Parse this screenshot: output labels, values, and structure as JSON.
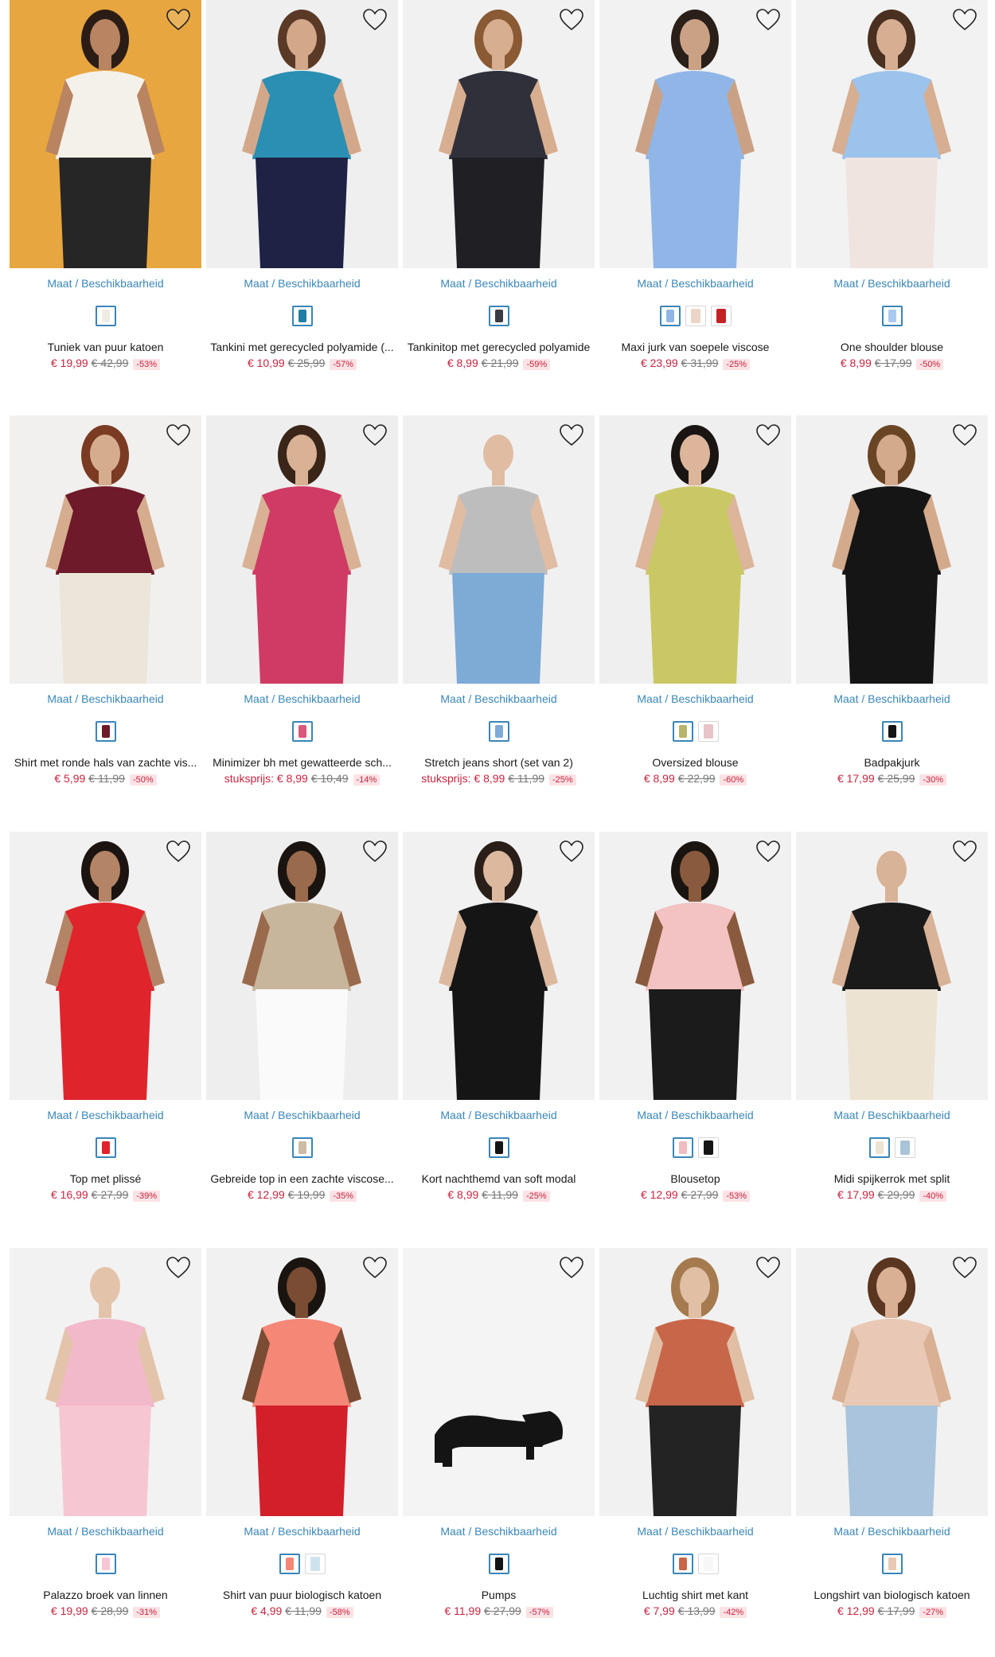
{
  "size_link_label": "Maat / Beschikbaarheid",
  "accent_color": "#3a86b8",
  "sale_color": "#c8243f",
  "icons": {
    "wishlist": "heart-outline-icon"
  },
  "products": [
    {
      "title": "Tuniek van puur katoen",
      "prefix": "",
      "price": "€ 19,99",
      "old_price": "€ 42,99",
      "discount": "-53%",
      "bg": "#e7a63f",
      "garment": "#f4f1ea",
      "lower": "#262626",
      "skin": "#b98461",
      "hair": "#2b1d16",
      "swatches": [
        "#efece4"
      ]
    },
    {
      "title": "Tankini met gerecycled polyamide (...",
      "prefix": "",
      "price": "€ 10,99",
      "old_price": "€ 25,99",
      "discount": "-57%",
      "bg": "#efefef",
      "garment": "#2a8fb3",
      "lower": "#1e2244",
      "skin": "#d3a88a",
      "hair": "#5a3a26",
      "swatches": [
        "#1f7ea3"
      ]
    },
    {
      "title": "Tankinitop met gerecycled polyamide",
      "prefix": "",
      "price": "€ 8,99",
      "old_price": "€ 21,99",
      "discount": "-59%",
      "bg": "#f1f1f1",
      "garment": "#30303a",
      "lower": "#1f1f24",
      "skin": "#d8ae90",
      "hair": "#8a5a34",
      "swatches": [
        "#3b3b44"
      ]
    },
    {
      "title": "Maxi jurk van soepele viscose",
      "prefix": "",
      "price": "€ 23,99",
      "old_price": "€ 31,99",
      "discount": "-25%",
      "bg": "#f2f2f2",
      "garment": "#8fb6e6",
      "lower": "#8fb6e6",
      "skin": "#caa184",
      "hair": "#2a1f19",
      "swatches": [
        "#8fb6e6",
        "#ead5c6",
        "#c42323"
      ]
    },
    {
      "title": "One shoulder blouse",
      "prefix": "",
      "price": "€ 8,99",
      "old_price": "€ 17,99",
      "discount": "-50%",
      "bg": "#f2f2f2",
      "garment": "#9cc3ec",
      "lower": "#f0e4e0",
      "skin": "#d6ae92",
      "hair": "#4a3020",
      "swatches": [
        "#a9c9ee"
      ]
    },
    {
      "title": "Shirt met ronde hals van zachte vis...",
      "prefix": "",
      "price": "€ 5,99",
      "old_price": "€ 11,99",
      "discount": "-50%",
      "bg": "#f1f0ee",
      "garment": "#6e1a2a",
      "lower": "#ebe5da",
      "skin": "#d6ac8e",
      "hair": "#7a3b22",
      "swatches": [
        "#6e1a2a"
      ]
    },
    {
      "title": "Minimizer bh met gewatteerde sch...",
      "prefix": "stuksprijs: ",
      "price": "€ 8,99",
      "old_price": "€ 10,49",
      "discount": "-14%",
      "bg": "#eeeeee",
      "garment": "#cf3b64",
      "lower": "#cf3b64",
      "skin": "#d9b195",
      "hair": "#3a2518",
      "swatches": [
        "#d95a7c"
      ]
    },
    {
      "title": "Stretch jeans short (set van 2)",
      "prefix": "stuksprijs: ",
      "price": "€ 8,99",
      "old_price": "€ 11,99",
      "discount": "-25%",
      "bg": "#f0f0f0",
      "garment": "#bdbdbd",
      "lower": "#7eaad6",
      "skin": "#e0bca3",
      "hair": "#f0f0f0",
      "swatches": [
        "#7eaad6"
      ]
    },
    {
      "title": "Oversized blouse",
      "prefix": "",
      "price": "€ 8,99",
      "old_price": "€ 22,99",
      "discount": "-60%",
      "bg": "#efefef",
      "garment": "#c9c865",
      "lower": "#c9c865",
      "skin": "#dcb59b",
      "hair": "#1a1512",
      "swatches": [
        "#b7b46a",
        "#e8c3c8"
      ]
    },
    {
      "title": "Badpakjurk",
      "prefix": "",
      "price": "€ 17,99",
      "old_price": "€ 25,99",
      "discount": "-30%",
      "bg": "#f1f1f1",
      "garment": "#151515",
      "lower": "#151515",
      "skin": "#d4aa8c",
      "hair": "#6a4524",
      "swatches": [
        "#151515"
      ]
    },
    {
      "title": "Top met plissé",
      "prefix": "",
      "price": "€ 16,99",
      "old_price": "€ 27,99",
      "discount": "-39%",
      "bg": "#f1f1f1",
      "garment": "#e0242b",
      "lower": "#e0242b",
      "skin": "#b48466",
      "hair": "#1c1410",
      "swatches": [
        "#e0242b"
      ]
    },
    {
      "title": "Gebreide top in een zachte viscose...",
      "prefix": "",
      "price": "€ 12,99",
      "old_price": "€ 19,99",
      "discount": "-35%",
      "bg": "#eeeeee",
      "garment": "#c8b69c",
      "lower": "#fafafa",
      "skin": "#9a6a4c",
      "hair": "#1a1410",
      "swatches": [
        "#cdbca3"
      ]
    },
    {
      "title": "Kort nachthemd van soft modal",
      "prefix": "",
      "price": "€ 8,99",
      "old_price": "€ 11,99",
      "discount": "-25%",
      "bg": "#f1f1f1",
      "garment": "#151515",
      "lower": "#151515",
      "skin": "#dcb89f",
      "hair": "#2a1e18",
      "swatches": [
        "#151515"
      ]
    },
    {
      "title": "Blousetop",
      "prefix": "",
      "price": "€ 12,99",
      "old_price": "€ 27,99",
      "discount": "-53%",
      "bg": "#f1f1f1",
      "garment": "#f3c2c2",
      "lower": "#1b1b1b",
      "skin": "#8a5a3e",
      "hair": "#1a1410",
      "swatches": [
        "#f0bcc0",
        "#151515"
      ]
    },
    {
      "title": "Midi spijkerrok met split",
      "prefix": "",
      "price": "€ 17,99",
      "old_price": "€ 29,99",
      "discount": "-40%",
      "bg": "#f1f1f1",
      "garment": "#1a1a1a",
      "lower": "#ece3d2",
      "skin": "#d9b397",
      "hair": "#f1f1f1",
      "swatches": [
        "#ece3d2",
        "#a9c4d6"
      ]
    },
    {
      "title": "Palazzo broek van linnen",
      "prefix": "",
      "price": "€ 19,99",
      "old_price": "€ 28,99",
      "discount": "-31%",
      "bg": "#f2f2f2",
      "garment": "#f2b9ca",
      "lower": "#f6c7d3",
      "skin": "#e4c3ab",
      "hair": "#f2f2f2",
      "swatches": [
        "#f6c7d3"
      ]
    },
    {
      "title": "Shirt van puur biologisch katoen",
      "prefix": "",
      "price": "€ 4,99",
      "old_price": "€ 11,99",
      "discount": "-58%",
      "bg": "#f1f1f1",
      "garment": "#f58777",
      "lower": "#d21f2a",
      "skin": "#7a4c34",
      "hair": "#1a1410",
      "swatches": [
        "#f58777",
        "#cfe3ef"
      ]
    },
    {
      "title": "Pumps",
      "prefix": "",
      "price": "€ 11,99",
      "old_price": "€ 27,99",
      "discount": "-57%",
      "bg": "#f4f4f4",
      "garment": "#141414",
      "lower": "#141414",
      "skin": "#f4f4f4",
      "hair": "#f4f4f4",
      "swatches": [
        "#141414"
      ]
    },
    {
      "title": "Luchtig shirt met kant",
      "prefix": "",
      "price": "€ 7,99",
      "old_price": "€ 13,99",
      "discount": "-42%",
      "bg": "#f1f1f1",
      "garment": "#c8664a",
      "lower": "#232323",
      "skin": "#e0bfa4",
      "hair": "#a57a4e",
      "swatches": [
        "#c8664a",
        "#f7f7f7"
      ]
    },
    {
      "title": "Longshirt van biologisch katoen",
      "prefix": "",
      "price": "€ 12,99",
      "old_price": "€ 17,99",
      "discount": "-27%",
      "bg": "#f1f1f1",
      "garment": "#e9c8b5",
      "lower": "#a9c4dc",
      "skin": "#d9b093",
      "hair": "#5a3520",
      "swatches": [
        "#e9c8b5"
      ]
    }
  ]
}
